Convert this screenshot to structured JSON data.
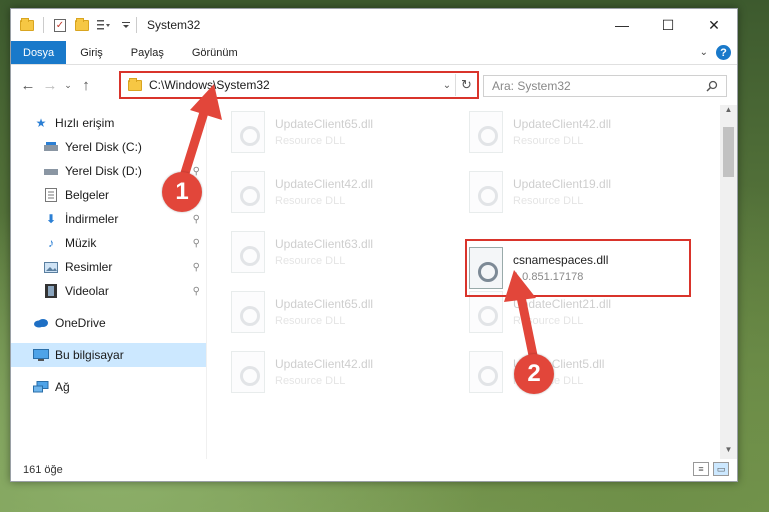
{
  "window": {
    "title": "System32",
    "controls": {
      "minimize": "—",
      "maximize": "☐",
      "close": "✕"
    }
  },
  "ribbon": {
    "tabs": [
      "Dosya",
      "Giriş",
      "Paylaş",
      "Görünüm"
    ]
  },
  "address": {
    "path": "C:\\Windows\\System32"
  },
  "search": {
    "placeholder": "Ara: System32"
  },
  "sidebar": {
    "items": [
      {
        "label": "Hızlı erişim",
        "icon": "star-icon"
      },
      {
        "label": "Yerel Disk (C:)",
        "icon": "drive-icon"
      },
      {
        "label": "Yerel Disk (D:)",
        "icon": "drive-icon"
      },
      {
        "label": "Belgeler",
        "icon": "documents-icon"
      },
      {
        "label": "İndirmeler",
        "icon": "download-icon"
      },
      {
        "label": "Müzik",
        "icon": "music-icon"
      },
      {
        "label": "Resimler",
        "icon": "pictures-icon"
      },
      {
        "label": "Videolar",
        "icon": "video-icon"
      },
      {
        "label": "OneDrive",
        "icon": "cloud-icon"
      },
      {
        "label": "Bu bilgisayar",
        "icon": "computer-icon"
      },
      {
        "label": "Ağ",
        "icon": "network-icon"
      }
    ]
  },
  "files": {
    "left": [
      {
        "name": "UpdateClient65.dll",
        "type": "Resource DLL"
      },
      {
        "name": "UpdateClient42.dll",
        "type": "Resource DLL"
      },
      {
        "name": "UpdateClient63.dll",
        "type": "Resource DLL"
      },
      {
        "name": "UpdateClient65.dll",
        "type": "Resource DLL"
      },
      {
        "name": "UpdateClient42.dll",
        "type": "Resource DLL"
      }
    ],
    "right": [
      {
        "name": "UpdateClient42.dll",
        "type": "Resource DLL"
      },
      {
        "name": "UpdateClient19.dll",
        "type": "Resource DLL"
      },
      {
        "name": "csnamespaces.dll",
        "type": "1.0.851.17178"
      },
      {
        "name": "UpdateClient21.dll",
        "type": "Resource DLL"
      },
      {
        "name": "UpdateClient5.dll",
        "type": "Resource DLL"
      }
    ]
  },
  "status": {
    "count": "161 öğe"
  },
  "markers": {
    "one": "1",
    "two": "2"
  },
  "colors": {
    "accent": "#1979ca",
    "highlight": "#d9342b",
    "marker": "#e2463a"
  }
}
